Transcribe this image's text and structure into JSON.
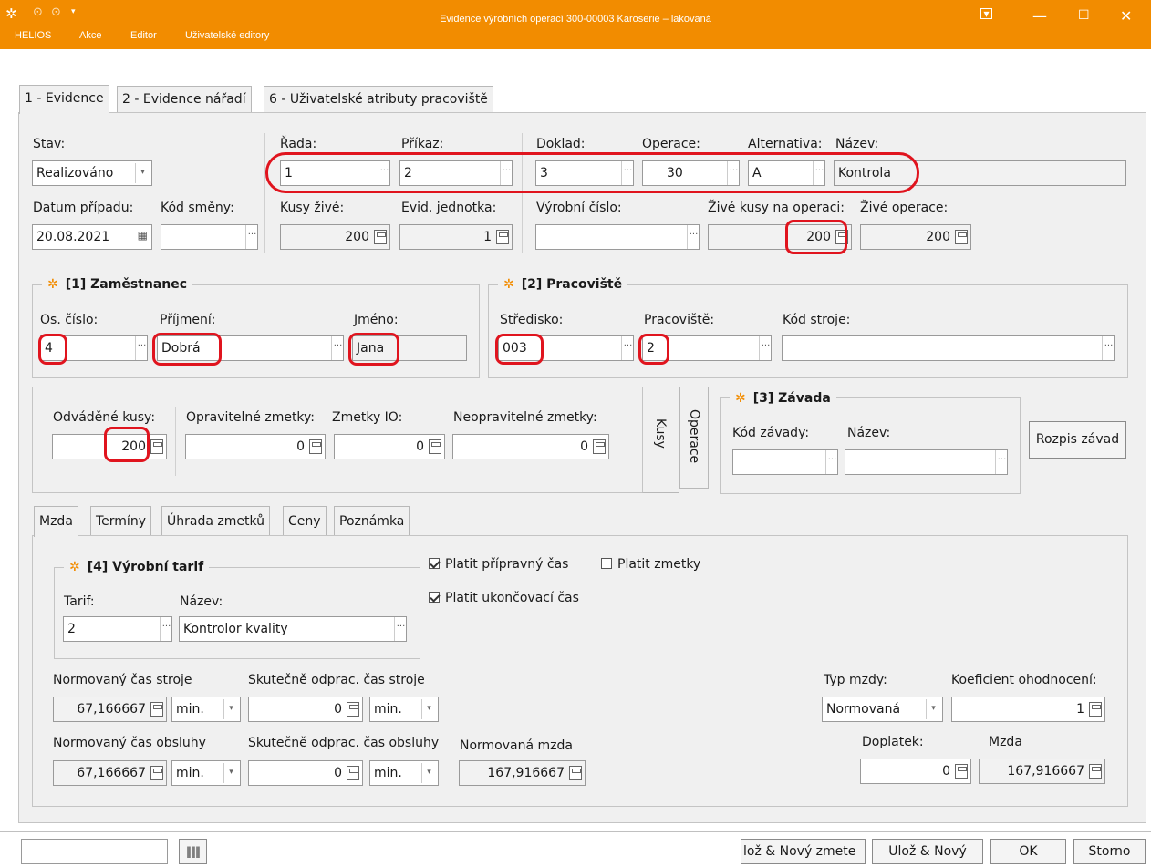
{
  "window": {
    "title": "Evidence výrobních operací   300-00003  Karoserie – lakovaná",
    "menu": [
      "HELIOS",
      "Akce",
      "Editor",
      "Uživatelské editory"
    ]
  },
  "tabs": [
    "1 - Evidence",
    "2 - Evidence nářadí",
    "6 - Uživatelské atributy pracoviště"
  ],
  "header": {
    "stav_label": "Stav:",
    "stav_value": "Realizováno",
    "rada_label": "Řada:",
    "rada_value": "1",
    "prikaz_label": "Příkaz:",
    "prikaz_value": "2",
    "doklad_label": "Doklad:",
    "doklad_value": "3",
    "operace_label": "Operace:",
    "operace_value": "30",
    "alternativa_label": "Alternativa:",
    "alternativa_value": "A",
    "nazev_label": "Název:",
    "nazev_value": "Kontrola",
    "datum_label": "Datum případu:",
    "datum_value": "20.08.2021",
    "smena_label": "Kód směny:",
    "smena_value": "",
    "kusy_zive_label": "Kusy živé:",
    "kusy_zive_value": "200",
    "evid_label": "Evid. jednotka:",
    "evid_value": "1",
    "vyrobni_label": "Výrobní číslo:",
    "vyrobni_value": "",
    "zive_kusy_op_label": "Živé kusy na operaci:",
    "zive_kusy_op_value": "200",
    "zive_op_label": "Živé operace:",
    "zive_op_value": "200"
  },
  "zamestnanec": {
    "title": "[1] Zaměstnanec",
    "os_label": "Os. číslo:",
    "os_value": "4",
    "prijmeni_label": "Příjmení:",
    "prijmeni_value": "Dobrá",
    "jmeno_label": "Jméno:",
    "jmeno_value": "Jana"
  },
  "pracoviste": {
    "title": "[2] Pracoviště",
    "stredisko_label": "Středisko:",
    "stredisko_value": "003",
    "prac_label": "Pracoviště:",
    "prac_value": "2",
    "stroj_label": "Kód stroje:",
    "stroj_value": ""
  },
  "kusy": {
    "odvadene_label": "Odváděné kusy:",
    "odvadene_value": "200",
    "opravitelne_label": "Opravitelné zmetky:",
    "opravitelne_value": "0",
    "zmetky_io_label": "Zmetky IO:",
    "zmetky_io_value": "0",
    "neopravitelne_label": "Neopravitelné zmetky:",
    "neopravitelne_value": "0",
    "vtab_kusy": "Kusy",
    "vtab_operace": "Operace"
  },
  "zavada": {
    "title": "[3] Závada",
    "kod_label": "Kód závady:",
    "nazev_label": "Název:",
    "rozpis_button": "Rozpis závad"
  },
  "subtabs": [
    "Mzda",
    "Termíny",
    "Úhrada zmetků",
    "Ceny",
    "Poznámka"
  ],
  "mzda": {
    "tarif_title": "[4] Výrobní tarif",
    "tarif_label": "Tarif:",
    "tarif_value": "2",
    "tarif_nazev_label": "Název:",
    "tarif_nazev_value": "Kontrolor kvality",
    "platit_pripravny": "Platit přípravný čas",
    "platit_zmetky": "Platit zmetky",
    "platit_ukoncovaci": "Platit ukončovací čas",
    "norm_stroje_label": "Normovaný čas stroje",
    "norm_stroje_value": "67,166667",
    "norm_stroje_unit": "min.",
    "skut_stroje_label": "Skutečně odprac. čas stroje",
    "skut_stroje_value": "0",
    "skut_stroje_unit": "min.",
    "norm_obsluhy_label": "Normovaný čas obsluhy",
    "norm_obsluhy_value": "67,166667",
    "norm_obsluhy_unit": "min.",
    "skut_obsluhy_label": "Skutečně odprac. čas obsluhy",
    "skut_obsluhy_value": "0",
    "skut_obsluhy_unit": "min.",
    "norm_mzda_label": "Normovaná mzda",
    "norm_mzda_value": "167,916667",
    "typ_label": "Typ mzdy:",
    "typ_value": "Normovaná",
    "koef_label": "Koeficient ohodnocení:",
    "koef_value": "1",
    "doplatek_label": "Doplatek:",
    "doplatek_value": "0",
    "mzda_label": "Mzda",
    "mzda_value": "167,916667"
  },
  "footer": {
    "search_value": "",
    "btn_uloz_zmetek": "lož & Nový zmete",
    "btn_uloz_novy": "Ulož & Nový",
    "btn_ok": "OK",
    "btn_storno": "Storno"
  },
  "colors": {
    "accent": "#f28c00",
    "highlight": "#e0141e"
  }
}
